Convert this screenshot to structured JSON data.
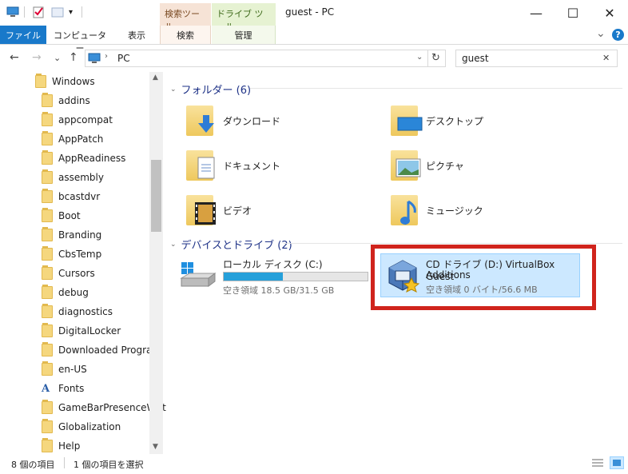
{
  "titlebar": {
    "title": "guest - PC",
    "ctx_search": "検索ツール",
    "ctx_drive": "ドライブ ツール",
    "minimize": "—",
    "maximize": "☐",
    "close": "✕"
  },
  "ribbon": {
    "file": "ファイル",
    "computer": "コンピューター",
    "view": "表示",
    "search": "検索",
    "manage": "管理",
    "expand": "⌄",
    "help": "?"
  },
  "navbar": {
    "back": "←",
    "forward": "→",
    "recent": "⌄",
    "up": "↑",
    "address": "PC",
    "refresh": "↻",
    "search_value": "guest",
    "clear": "✕"
  },
  "tree": [
    "Windows",
    "addins",
    "appcompat",
    "AppPatch",
    "AppReadiness",
    "assembly",
    "bcastdvr",
    "Boot",
    "Branding",
    "CbsTemp",
    "Cursors",
    "debug",
    "diagnostics",
    "DigitalLocker",
    "Downloaded Program",
    "en-US",
    "Fonts",
    "GameBarPresenceWrit",
    "Globalization",
    "Help"
  ],
  "content": {
    "folders_header": "フォルダー (6)",
    "folders": [
      "ダウンロード",
      "デスクトップ",
      "ドキュメント",
      "ピクチャ",
      "ビデオ",
      "ミュージック"
    ],
    "devices_header": "デバイスとドライブ (2)",
    "drive_c": {
      "name": "ローカル ディスク (C:)",
      "space": "空き領域 18.5 GB/31.5 GB",
      "used_fraction": 0.41
    },
    "drive_d": {
      "name_line1": "CD ドライブ (D:) VirtualBox Guest",
      "name_line2": "Additions",
      "space": "空き領域 0 バイト/56.6 MB"
    }
  },
  "status": {
    "count": "8 個の項目",
    "selected": "1 個の項目を選択"
  },
  "colors": {
    "accent": "#1979ca",
    "highlight": "#cce8ff",
    "red_box": "#d0241c"
  }
}
